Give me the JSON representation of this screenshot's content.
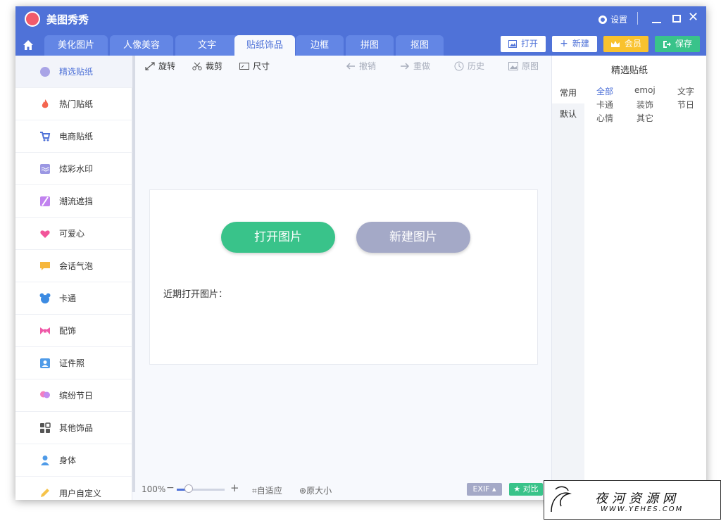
{
  "app": {
    "title": "美图秀秀",
    "settings_label": "设置"
  },
  "tabs": [
    {
      "label": "美化图片"
    },
    {
      "label": "人像美容"
    },
    {
      "label": "文字"
    },
    {
      "label": "贴纸饰品",
      "active": true
    },
    {
      "label": "边框"
    },
    {
      "label": "拼图"
    },
    {
      "label": "抠图"
    }
  ],
  "topbuttons": {
    "open": "打开",
    "new": "新建",
    "vip": "会员",
    "save": "保存"
  },
  "sidebar": {
    "items": [
      {
        "label": "精选贴纸",
        "icon": "sticker-icon"
      },
      {
        "label": "热门贴纸",
        "icon": "fire-icon"
      },
      {
        "label": "电商贴纸",
        "icon": "cart-icon"
      },
      {
        "label": "炫彩水印",
        "icon": "watermark-icon"
      },
      {
        "label": "潮流遮挡",
        "icon": "mask-icon"
      },
      {
        "label": "可爱心",
        "icon": "heart-icon"
      },
      {
        "label": "会话气泡",
        "icon": "chat-bubble-icon"
      },
      {
        "label": "卡通",
        "icon": "cartoon-icon"
      },
      {
        "label": "配饰",
        "icon": "bow-icon"
      },
      {
        "label": "证件照",
        "icon": "id-photo-icon"
      },
      {
        "label": "缤纷节日",
        "icon": "balloon-icon"
      },
      {
        "label": "其他饰品",
        "icon": "grid-icon"
      },
      {
        "label": "身体",
        "icon": "person-icon"
      },
      {
        "label": "用户自定义",
        "icon": "pencil-icon"
      }
    ]
  },
  "toolbar": {
    "rotate": "旋转",
    "crop": "裁剪",
    "size": "尺寸",
    "undo": "撤销",
    "redo": "重做",
    "history": "历史",
    "original": "原图"
  },
  "canvas": {
    "open_image": "打开图片",
    "new_image": "新建图片",
    "recent_label": "近期打开图片："
  },
  "status": {
    "zoom": "100%",
    "fit": "自适应",
    "orig_size": "原大小",
    "exif": "EXIF",
    "compare": "对比"
  },
  "rightpanel": {
    "title": "精选贴纸",
    "tabs": [
      "常用",
      "默认"
    ],
    "categories": [
      "全部",
      "emoj",
      "文字",
      "卡通",
      "装饰",
      "节日",
      "心情",
      "其它"
    ]
  },
  "watermark": {
    "text": "夜河资源网",
    "url": "WWW.YEHES.COM"
  },
  "colors": {
    "primary": "#4f72d8",
    "green": "#39c38a",
    "gold": "#f9c22e",
    "grey_button": "#a4a9c7"
  }
}
